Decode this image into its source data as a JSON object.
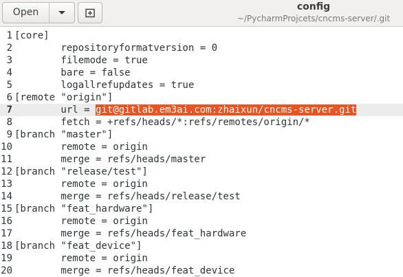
{
  "header": {
    "open_label": "Open",
    "title": "config",
    "subtitle": "~/PycharmProjcets/cncms-server/.git",
    "icons": {
      "dropdown": "chevron-down-icon",
      "new_tab": "new-tab-icon"
    }
  },
  "editor": {
    "current_line": 7,
    "selection_color": "#e95420",
    "lines": [
      {
        "num": "1",
        "text": "[core]"
      },
      {
        "num": "2",
        "text": "        repositoryformatversion = 0"
      },
      {
        "num": "3",
        "text": "        filemode = true"
      },
      {
        "num": "4",
        "text": "        bare = false"
      },
      {
        "num": "5",
        "text": "        logallrefupdates = true"
      },
      {
        "num": "6",
        "text": "[remote \"origin\"]"
      },
      {
        "num": "7",
        "pre": "        url = ",
        "selected": "git@gitlab.em3ai.com:zhaixun/cncms-server.git"
      },
      {
        "num": "8",
        "text": "        fetch = +refs/heads/*:refs/remotes/origin/*"
      },
      {
        "num": "9",
        "text": "[branch \"master\"]"
      },
      {
        "num": "10",
        "text": "        remote = origin"
      },
      {
        "num": "11",
        "text": "        merge = refs/heads/master"
      },
      {
        "num": "12",
        "text": "[branch \"release/test\"]"
      },
      {
        "num": "13",
        "text": "        remote = origin"
      },
      {
        "num": "14",
        "text": "        merge = refs/heads/release/test"
      },
      {
        "num": "15",
        "text": "[branch \"feat_hardware\"]"
      },
      {
        "num": "16",
        "text": "        remote = origin"
      },
      {
        "num": "17",
        "text": "        merge = refs/heads/feat_hardware"
      },
      {
        "num": "18",
        "text": "[branch \"feat_device\"]"
      },
      {
        "num": "19",
        "text": "        remote = origin"
      },
      {
        "num": "20",
        "text": "        merge = refs/heads/feat_device"
      }
    ]
  }
}
